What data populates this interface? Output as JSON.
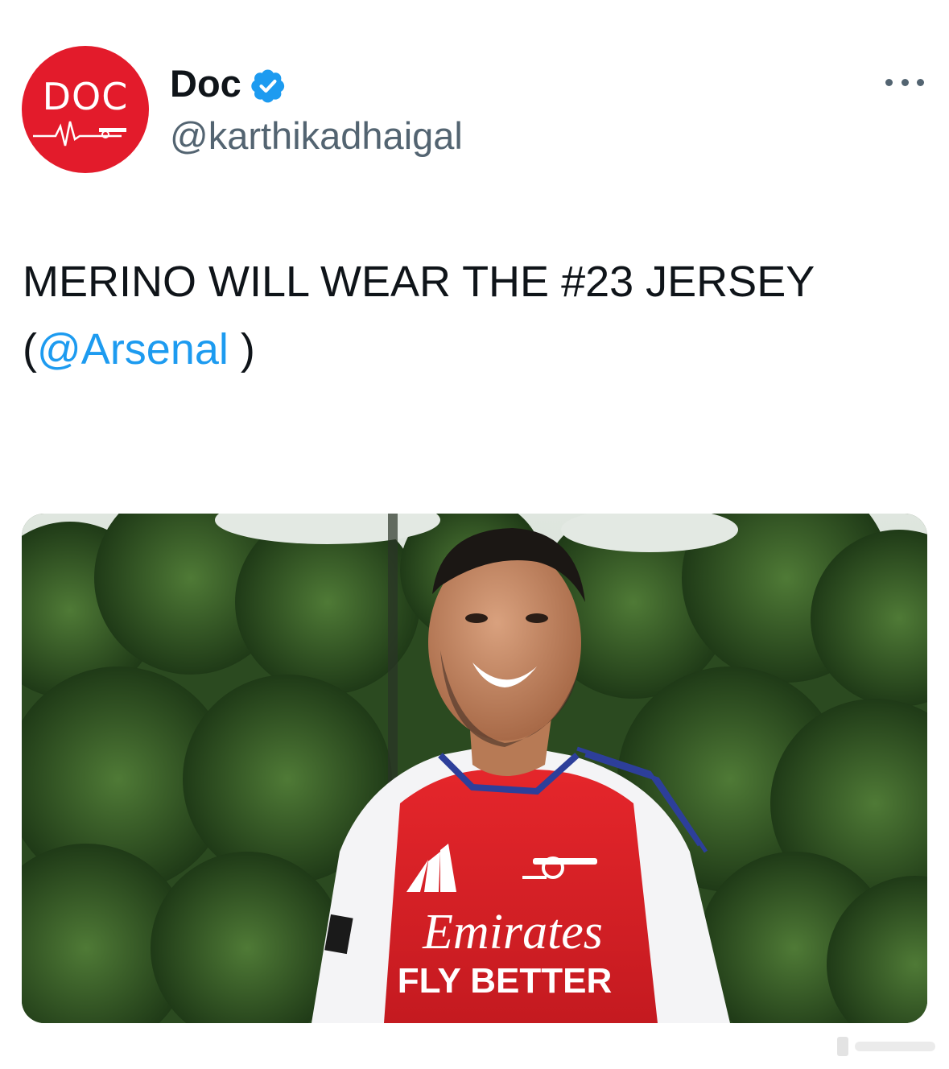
{
  "post": {
    "author": {
      "display_name": "Doc",
      "handle": "@karthikadhaigal",
      "verified": true,
      "avatar_text": "DOC",
      "avatar_color": "#e31b2b"
    },
    "more_icon": "more-horizontal-icon",
    "text_main": "MERINO WILL WEAR THE #23 JERSEY",
    "text_open": "(",
    "mention": "@Arsenal",
    "text_close": " )",
    "media": {
      "shirt_sponsor": "Emirates",
      "shirt_slogan": "FLY BETTER"
    }
  },
  "colors": {
    "text": "#0f1419",
    "secondary": "#536471",
    "link": "#1d9bf0",
    "verified": "#1d9bf0"
  }
}
